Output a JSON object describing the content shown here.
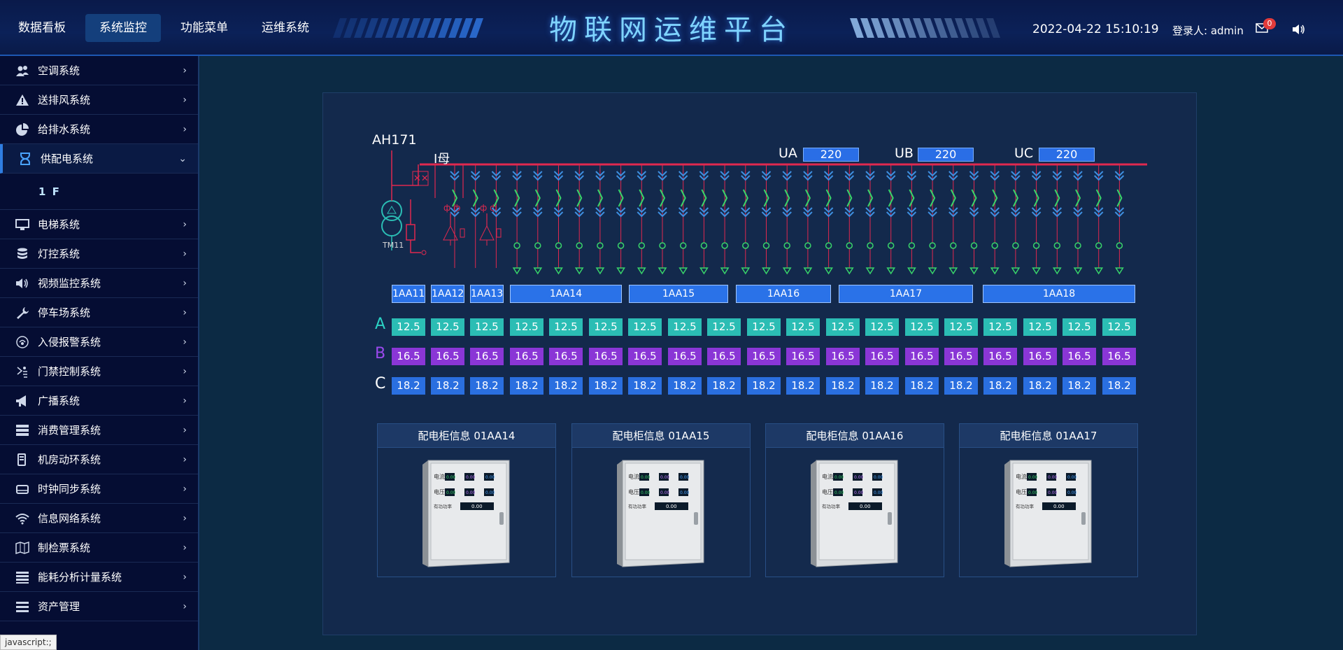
{
  "header": {
    "nav": [
      "数据看板",
      "系统监控",
      "功能菜单",
      "运维系统"
    ],
    "active_nav": "系统监控",
    "title": "物联网运维平台",
    "datetime": "2022-04-22 15:10:19",
    "user": "登录人:  admin",
    "mail_count": "0"
  },
  "sidebar": {
    "items": [
      {
        "label": "空调系统",
        "icon": "users-icon"
      },
      {
        "label": "送排风系统",
        "icon": "warning-icon"
      },
      {
        "label": "给排水系统",
        "icon": "pie-chart-icon"
      },
      {
        "label": "供配电系统",
        "icon": "hourglass-icon",
        "expanded": true
      },
      {
        "label": "电梯系统",
        "icon": "monitor-icon"
      },
      {
        "label": "灯控系统",
        "icon": "database-icon"
      },
      {
        "label": "视频监控系统",
        "icon": "speaker-icon"
      },
      {
        "label": "停车场系统",
        "icon": "wrench-icon"
      },
      {
        "label": "入侵报警系统",
        "icon": "alarm-icon"
      },
      {
        "label": "门禁控制系统",
        "icon": "access-icon"
      },
      {
        "label": "广播系统",
        "icon": "megaphone-icon"
      },
      {
        "label": "消费管理系统",
        "icon": "server-icon"
      },
      {
        "label": "机房动环系统",
        "icon": "device-icon"
      },
      {
        "label": "时钟同步系统",
        "icon": "drive-icon"
      },
      {
        "label": "信息网络系统",
        "icon": "wifi-icon"
      },
      {
        "label": "制检票系统",
        "icon": "map-icon"
      },
      {
        "label": "能耗分析计量系统",
        "icon": "bars-icon"
      },
      {
        "label": "资产管理",
        "icon": "list-icon"
      }
    ],
    "sub_item": "1 F",
    "status_tip": "javascript:;"
  },
  "diagram": {
    "transformer_label": "AH171",
    "bus_label": "I母",
    "tm_label": "TM11",
    "voltages": [
      {
        "name": "UA",
        "value": "220"
      },
      {
        "name": "UB",
        "value": "220"
      },
      {
        "name": "UC",
        "value": "220"
      }
    ],
    "cabinets": [
      "1AA11",
      "1AA12",
      "1AA13",
      "1AA14",
      "1AA15",
      "1AA16",
      "1AA17",
      "1AA18"
    ],
    "phases": [
      {
        "name": "A",
        "color": "#2bbdb4",
        "values": [
          "12.5",
          "12.5",
          "12.5",
          "12.5",
          "12.5",
          "12.5",
          "12.5",
          "12.5",
          "12.5",
          "12.5",
          "12.5",
          "12.5",
          "12.5",
          "12.5",
          "12.5",
          "12.5",
          "12.5",
          "12.5",
          "12.5"
        ]
      },
      {
        "name": "B",
        "color": "#8a36d6",
        "values": [
          "16.5",
          "16.5",
          "16.5",
          "16.5",
          "16.5",
          "16.5",
          "16.5",
          "16.5",
          "16.5",
          "16.5",
          "16.5",
          "16.5",
          "16.5",
          "16.5",
          "16.5",
          "16.5",
          "16.5",
          "16.5",
          "16.5"
        ]
      },
      {
        "name": "C",
        "color": "#2a6fe0",
        "values": [
          "18.2",
          "18.2",
          "18.2",
          "18.2",
          "18.2",
          "18.2",
          "18.2",
          "18.2",
          "18.2",
          "18.2",
          "18.2",
          "18.2",
          "18.2",
          "18.2",
          "18.2",
          "18.2",
          "18.2",
          "18.2",
          "18.2"
        ]
      }
    ]
  },
  "cards": [
    {
      "title": "配电柜信息  01AA14"
    },
    {
      "title": "配电柜信息  01AA15"
    },
    {
      "title": "配电柜信息  01AA16"
    },
    {
      "title": "配电柜信息  01AA17"
    }
  ],
  "cabinet_panel": {
    "current_label": "电流",
    "voltage_label": "电压",
    "power_label": "有功功率",
    "meter_value": "0.00",
    "power_value": "0.00"
  }
}
